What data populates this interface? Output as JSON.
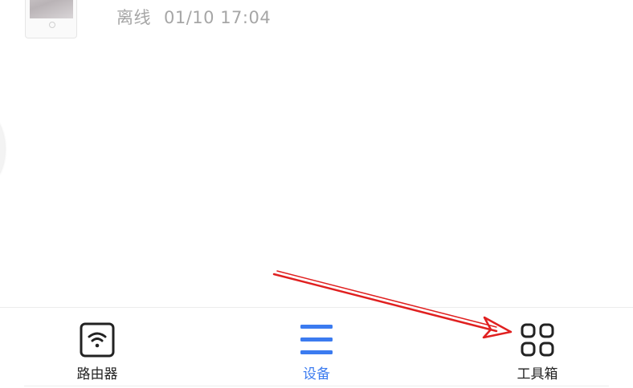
{
  "device": {
    "status": "离线",
    "last_seen": "01/10 17:04"
  },
  "bottom_nav": {
    "items": [
      {
        "label": "路由器",
        "icon": "router-wifi-icon",
        "active": false
      },
      {
        "label": "设备",
        "icon": "menu-lines-icon",
        "active": true
      },
      {
        "label": "工具箱",
        "icon": "grid-apps-icon",
        "active": false
      }
    ]
  },
  "colors": {
    "active": "#3b7bf0",
    "inactive": "#222222",
    "status_text": "#a6a6a6",
    "annotation": "#e02020"
  }
}
